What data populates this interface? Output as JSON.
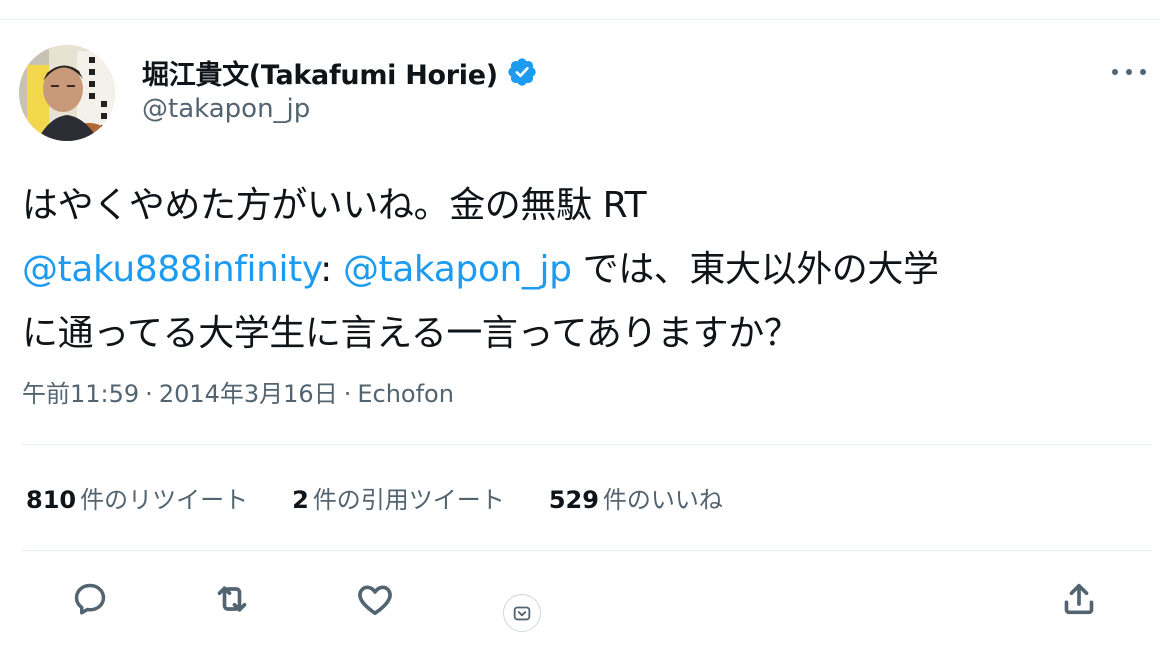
{
  "author": {
    "display_name": "堀江貴文(Takafumi Horie)",
    "handle": "@takapon_jp",
    "verified": true,
    "avatar_icon": "avatar-book-cover"
  },
  "tweet": {
    "line1": "はやくやめた方がいいね。金の無駄 RT",
    "rt_mention": "@taku888infinity",
    "colon": ":",
    "mention2": "@takapon_jp",
    "line2_rest": "では、東大以外の大学",
    "line3": "に通ってる大学生に言える一言ってありますか？"
  },
  "meta": {
    "time": "午前11:59",
    "date": "2014年3月16日",
    "source": "Echofon",
    "separator": "·"
  },
  "stats": {
    "retweets_count": "810",
    "retweets_label": "件のリツイート",
    "quotes_count": "2",
    "quotes_label": "件の引用ツイート",
    "likes_count": "529",
    "likes_label": "件のいいね"
  },
  "actions": [
    "reply-icon",
    "retweet-icon",
    "like-icon",
    "react-icon",
    "share-icon"
  ],
  "colors": {
    "link": "#1d9bf0",
    "verified": "#1d9bf0",
    "secondary_text": "#536471",
    "divider": "#e6ecf0"
  }
}
